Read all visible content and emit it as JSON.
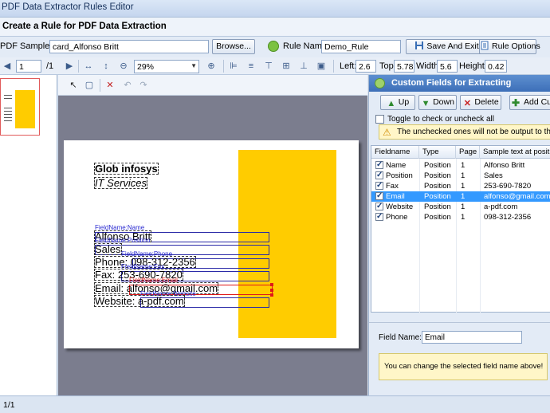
{
  "window": {
    "title": "PDF Data Extractor Rules Editor",
    "header": "Create a Rule for PDF Data Extraction"
  },
  "toolbar1": {
    "pdf_sample_label": "PDF Sample:",
    "pdf_sample_value": "card_Alfonso Britt",
    "browse_label": "Browse...",
    "rule_name_label": "Rule Name:",
    "rule_name_value": "Demo_Rule",
    "save_exit_label": "Save And Exit",
    "rule_options_label": "Rule Options"
  },
  "toolbar2": {
    "page_value": "1",
    "page_total": "/1",
    "zoom_value": "29%",
    "left_label": "Left:",
    "left_value": "2.6",
    "top_label": "Top:",
    "top_value": "5.78",
    "width_label": "Width:",
    "width_value": "5.6",
    "height_label": "Height:",
    "height_value": "0.42"
  },
  "card": {
    "company": "Glob infosys",
    "tagline": "IT Services",
    "name": "Alfonso Britt",
    "position": "Sales",
    "phone": "Phone: 098-312-2356",
    "fax": "Fax: 253-690-7820",
    "email": "Email: alfonso@gmail.com",
    "website": "Website: a-pdf.com"
  },
  "field_labels": {
    "name": "FieldName:Name",
    "position": "FieldName:Position",
    "phone": "FieldName:Phone",
    "fax": "FieldName:Fax",
    "email": "FieldName:Email",
    "website": "FieldName:Website"
  },
  "right_panel": {
    "title": "Custom Fields for Extracting",
    "up_label": "Up",
    "down_label": "Down",
    "delete_label": "Delete",
    "add_label": "Add Custom Field",
    "toggle_label": "Toggle to check or uncheck all",
    "warning": "The unchecked ones will not be output to the result file",
    "columns": [
      "Fieldname",
      "Type",
      "Page",
      "Sample text at position"
    ],
    "rows": [
      {
        "name": "Name",
        "type": "Position",
        "page": "1",
        "sample": "Alfonso Britt"
      },
      {
        "name": "Position",
        "type": "Position",
        "page": "1",
        "sample": "Sales"
      },
      {
        "name": "Fax",
        "type": "Position",
        "page": "1",
        "sample": "253-690-7820"
      },
      {
        "name": "Email",
        "type": "Position",
        "page": "1",
        "sample": " alfonso@gmail.com"
      },
      {
        "name": "Website",
        "type": "Position",
        "page": "1",
        "sample": "a-pdf.com"
      },
      {
        "name": "Phone",
        "type": "Position",
        "page": "1",
        "sample": "098-312-2356"
      }
    ],
    "field_name_label": "Field Name:",
    "field_name_value": "Email",
    "info": "You can change the selected field name above!"
  },
  "status": {
    "page": "1/1"
  },
  "colors": {
    "accent": "#3d6fb8",
    "card_yellow": "#ffcc00",
    "selection": "#3399ff",
    "field_box": "#2a2aa8",
    "selected_field_box": "#e01818"
  }
}
